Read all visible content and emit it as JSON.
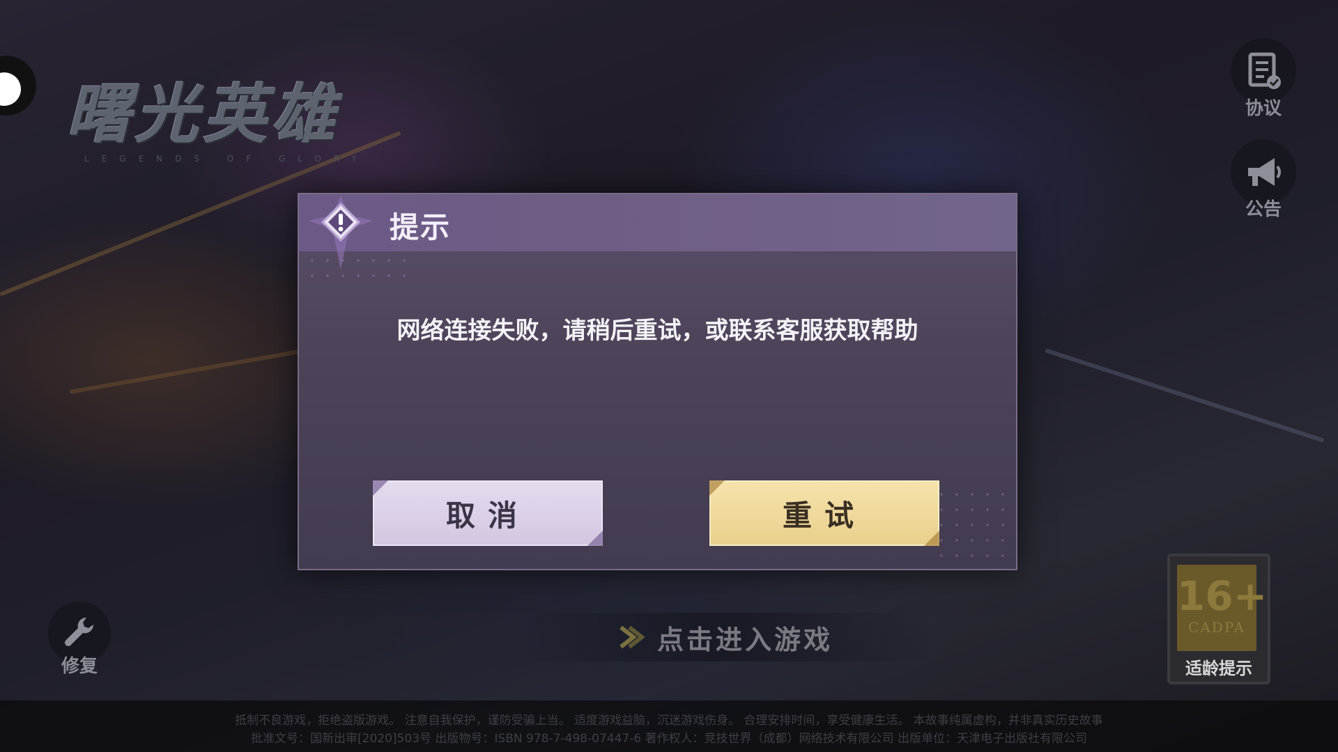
{
  "background": {
    "logo_title": "曙光英雄",
    "logo_subtitle": "LEGENDS OF GLORY"
  },
  "sidebar_right": {
    "agreement_label": "协议",
    "notice_label": "公告"
  },
  "repair": {
    "label": "修复"
  },
  "start": {
    "label": "点击进入游戏"
  },
  "age_rating": {
    "number": "16+",
    "org": "CADPA",
    "label": "适龄提示"
  },
  "footer": {
    "line1": "抵制不良游戏，拒绝盗版游戏。 注意自我保护，谨防受骗上当。 适度游戏益脑，沉迷游戏伤身。 合理安排时间，享受健康生活。 本故事纯属虚构，并非真实历史故事",
    "line2": "批准文号：国新出审[2020]503号  出版物号：ISBN 978-7-498-07447-6  著作权人：竞技世界（成都）网络技术有限公司  出版单位：天津电子出版社有限公司"
  },
  "dialog": {
    "title": "提示",
    "message": "网络连接失败，请稍后重试，或联系客服获取帮助",
    "cancel_label": "取消",
    "retry_label": "重试"
  },
  "colors": {
    "dialog_bg": "#4c4358",
    "dialog_header": "#6f5f84",
    "cancel_button": "#dcd0e8",
    "retry_button": "#f0d99a"
  }
}
